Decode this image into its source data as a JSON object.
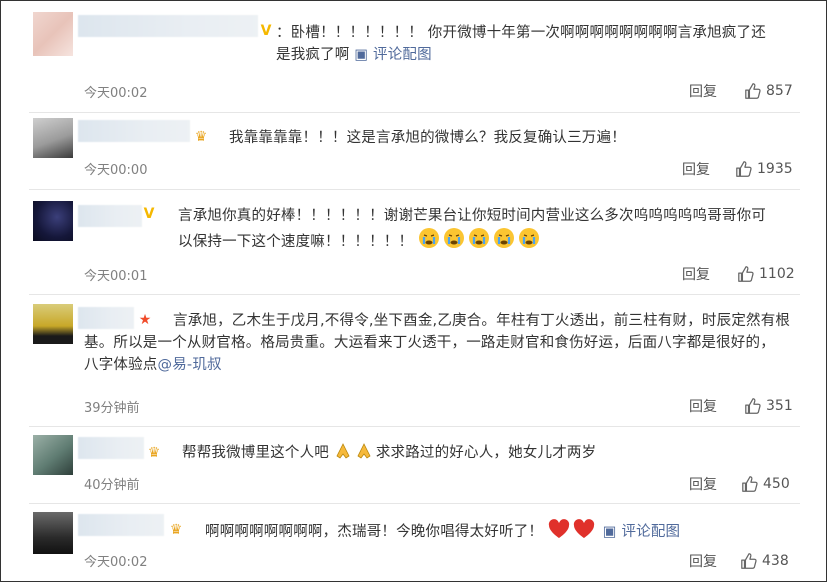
{
  "comments": [
    {
      "text_lines": [
        "：卧槽！！！！！！！ 你开微博十年第一次啊啊啊啊啊啊啊啊言承旭疯了还",
        "是我疯了啊"
      ],
      "image_link": "评论配图",
      "time": "今天00:02",
      "reply": "回复",
      "likes": "857"
    },
    {
      "text_lines": [
        "我靠靠靠靠！！！这是言承旭的微博么？我反复确认三万遍！"
      ],
      "time": "今天00:00",
      "reply": "回复",
      "likes": "1935"
    },
    {
      "text_lines": [
        "言承旭你真的好棒！！！！！！谢谢芒果台让你短时间内营业这么多次呜呜呜呜呜哥哥你可",
        "以保持一下这个速度嘛！！！！！！"
      ],
      "time": "今天00:01",
      "reply": "回复",
      "likes": "1102"
    },
    {
      "text_lines": [
        "言承旭，乙木生于戊月,不得令,坐下酉金,乙庚合。年柱有丁火透出，前三柱有财，时辰定然有根",
        "基。所以是一个从财官格。格局贵重。大运看来丁火透干，一路走财官和食伤好运，后面八字都是很好的，",
        "八字体验点"
      ],
      "mention": "@易-玑叔",
      "time": "39分钟前",
      "reply": "回复",
      "likes": "351"
    },
    {
      "text_lines_a": "帮帮我微博里这个人吧",
      "text_lines_b": "求求路过的好心人，她女儿才两岁",
      "time": "40分钟前",
      "reply": "回复",
      "likes": "450"
    },
    {
      "text_lines": [
        "啊啊啊啊啊啊啊啊，杰瑞哥！今晚你唱得太好听了！"
      ],
      "image_link": "评论配图",
      "time": "今天00:02",
      "reply": "回复",
      "likes": "438"
    }
  ],
  "icons": {
    "vip": "v-badge-icon",
    "crown": "crown-icon",
    "star": "star-icon",
    "crying": "crying-emoji-icon",
    "pray": "pray-emoji-icon",
    "heart": "heart-emoji-icon",
    "thumb": "thumb-up-icon"
  },
  "colors": {
    "link": "#506a9b",
    "heart": "#e0312b",
    "crown": "#e9a520",
    "vip": "#f5b800"
  }
}
